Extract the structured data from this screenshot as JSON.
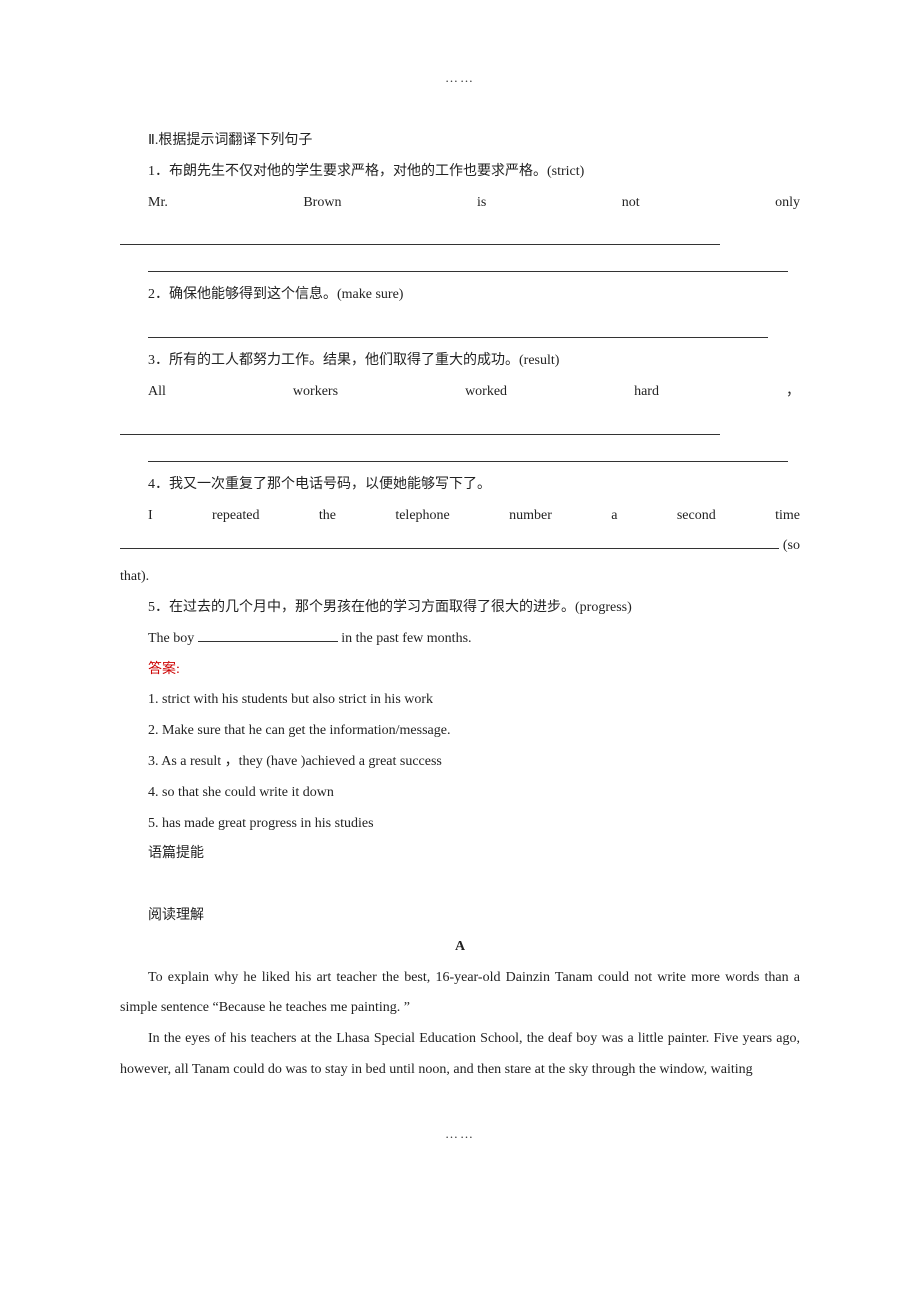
{
  "header_dots": "……",
  "footer_dots": "……",
  "section2": {
    "title": "Ⅱ.根据提示词翻译下列句子",
    "q1": {
      "prompt": "1．布朗先生不仅对他的学生要求严格，对他的工作也要求严格。(strict)",
      "w1": "Mr.",
      "w2": "Brown",
      "w3": "is",
      "w4": "not",
      "w5": "only"
    },
    "q2": {
      "prompt": "2．确保他能够得到这个信息。(make sure)"
    },
    "q3": {
      "prompt": "3．所有的工人都努力工作。结果，他们取得了重大的成功。(result)",
      "w1": "All",
      "w2": "workers",
      "w3": "worked",
      "w4": "hard",
      "w5": "，"
    },
    "q4": {
      "prompt": "4．我又一次重复了那个电话号码，以便她能够写下了。",
      "w1": "I",
      "w2": "repeated",
      "w3": "the",
      "w4": "telephone",
      "w5": "number",
      "w6": "a",
      "w7": "second",
      "w8": "time",
      "tail": "(so",
      "cont": "that)."
    },
    "q5": {
      "prompt": "5．在过去的几个月中，那个男孩在他的学习方面取得了很大的进步。(progress)",
      "sentence_pre": "The boy ",
      "sentence_post": " in the past few months."
    }
  },
  "answers": {
    "label": "答案:",
    "a1": "1. strict with his students but also strict in his work",
    "a2": "2. Make sure that he can get the information/message.",
    "a3": "3. As a result ，they (have )achieved a great success",
    "a4": "4. so that she could write it down",
    "a5": "5. has made great progress in his studies"
  },
  "subheading_skill": "语篇提能",
  "subheading_reading": "阅读理解",
  "passage": {
    "label": "A",
    "p1": "To explain why he liked his art teacher the best, 16-year-old Dainzin Tanam could not write more words than a simple sentence “Because he teaches me painting. ”",
    "p2": "In the eyes of his teachers at the Lhasa Special Education School, the deaf boy was a little painter. Five years ago, however, all Tanam could do was to stay in bed until noon, and then stare at the sky through the window, waiting"
  }
}
